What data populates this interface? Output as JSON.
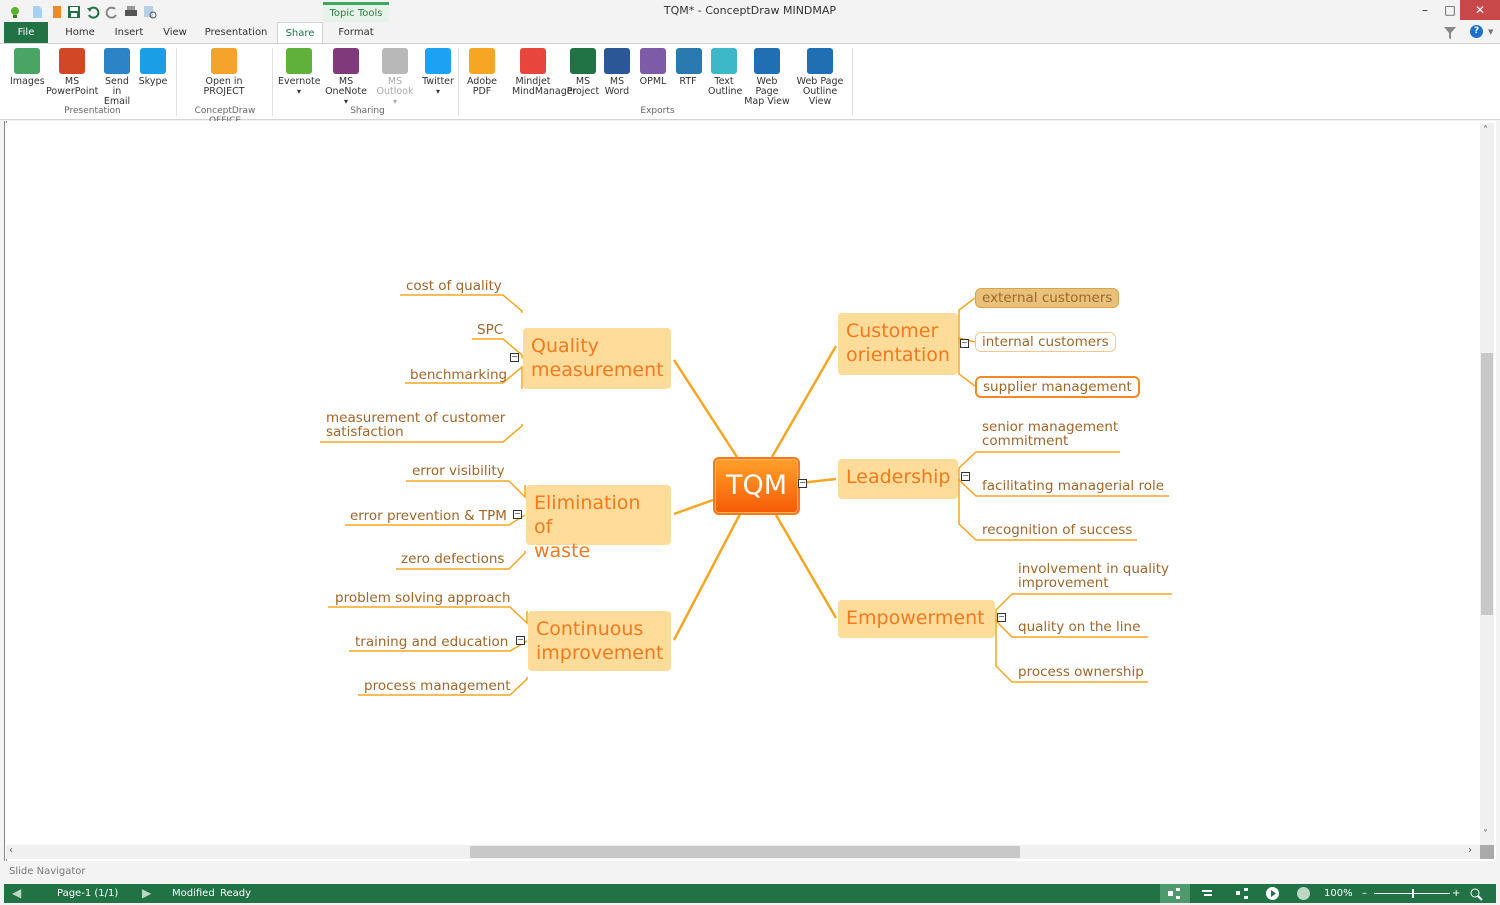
{
  "window": {
    "title": "TQM* - ConceptDraw MINDMAP",
    "contextual_tab": "Topic Tools",
    "minimize": "–",
    "maximize": "□",
    "close": "✕"
  },
  "quick_access": [
    "app-logo-icon",
    "new-icon",
    "open-icon",
    "save-icon",
    "undo-icon",
    "redo-icon",
    "print-icon",
    "print-preview-icon"
  ],
  "tabs": [
    {
      "label": "File",
      "active": false
    },
    {
      "label": "Home",
      "active": false
    },
    {
      "label": "Insert",
      "active": false
    },
    {
      "label": "View",
      "active": false
    },
    {
      "label": "Presentation",
      "active": false
    },
    {
      "label": "Share",
      "active": true
    },
    {
      "label": "Format",
      "active": false
    }
  ],
  "search": {
    "value": "",
    "placeholder": "",
    "clear": "✕"
  },
  "ribbon": {
    "groups": [
      {
        "label": "Presentation",
        "buttons": [
          {
            "label": "Images",
            "icon": "images-icon",
            "color": "#4aa564"
          },
          {
            "label": "MS\nPowerPoint",
            "icon": "powerpoint-icon",
            "color": "#d24726"
          },
          {
            "label": "Send in\nEmail",
            "icon": "email-icon",
            "color": "#2c83c5"
          },
          {
            "label": "Skype",
            "icon": "skype-icon",
            "color": "#1a9ee6"
          }
        ]
      },
      {
        "label": "ConceptDraw OFFICE",
        "buttons": [
          {
            "label": "Open in\nPROJECT",
            "icon": "project-icon",
            "color": "#f4a42b"
          }
        ]
      },
      {
        "label": "Sharing",
        "buttons": [
          {
            "label": "Evernote",
            "icon": "evernote-icon",
            "color": "#5fb13c",
            "dropdown": true
          },
          {
            "label": "MS\nOneNote",
            "icon": "onenote-icon",
            "color": "#80397b",
            "dropdown": true
          },
          {
            "label": "MS\nOutlook",
            "icon": "outlook-icon",
            "color": "#b8b8b8",
            "dropdown": true,
            "disabled": true
          },
          {
            "label": "Twitter",
            "icon": "twitter-icon",
            "color": "#1da1f2",
            "dropdown": true
          }
        ]
      },
      {
        "label": "Exports",
        "buttons": [
          {
            "label": "Adobe\nPDF",
            "icon": "pdf-icon",
            "color": "#f6a623"
          },
          {
            "label": "Mindjet\nMindManager",
            "icon": "mindmanager-icon",
            "color": "#e8453c"
          },
          {
            "label": "MS\nProject",
            "icon": "msproject-icon",
            "color": "#217346"
          },
          {
            "label": "MS\nWord",
            "icon": "word-icon",
            "color": "#2b5797"
          },
          {
            "label": "OPML",
            "icon": "opml-icon",
            "color": "#7d5ba6"
          },
          {
            "label": "RTF",
            "icon": "rtf-icon",
            "color": "#2a7ab0"
          },
          {
            "label": "Text\nOutline",
            "icon": "text-outline-icon",
            "color": "#3cb8c8"
          },
          {
            "label": "Web Page\nMap View",
            "icon": "web-map-icon",
            "color": "#1f6fb2"
          },
          {
            "label": "Web Page\nOutline View",
            "icon": "web-outline-icon",
            "color": "#1f6fb2"
          }
        ]
      }
    ]
  },
  "mindmap": {
    "central": "TQM",
    "branches": [
      {
        "id": "quality",
        "label": "Quality\nmeasurement",
        "children": [
          "cost of quality",
          "SPC",
          "benchmarking",
          "measurement of customer\nsatisfaction"
        ]
      },
      {
        "id": "waste",
        "label": "Elimination of\nwaste",
        "children": [
          "error visibility",
          "error prevention & TPM",
          "zero defections"
        ]
      },
      {
        "id": "continuous",
        "label": "Continuous\nimprovement",
        "children": [
          "problem solving approach",
          "training and education",
          "process management"
        ]
      },
      {
        "id": "customer",
        "label": "Customer\norientation",
        "children": [
          "external customers",
          "internal customers",
          "supplier management"
        ]
      },
      {
        "id": "leadership",
        "label": "Leadership",
        "children": [
          "senior management\ncommitment",
          "facilitating managerial role",
          "recognition of success"
        ]
      },
      {
        "id": "empowerment",
        "label": "Empowerment",
        "children": [
          "involvement in quality\nimprovement",
          "quality on the line",
          "process ownership"
        ]
      }
    ],
    "colors": {
      "line": "#f5a623",
      "main_fill": "#ffdc9a",
      "main_text": "#f5791d",
      "sub_text": "#a0662a",
      "central_fill": "#f5791d"
    }
  },
  "slide_navigator": "Slide Navigator",
  "status": {
    "page": "Page-1 (1/1)",
    "modified": "Modified",
    "ready": "Ready",
    "zoom": "100%",
    "zoom_level_pct": 100
  }
}
